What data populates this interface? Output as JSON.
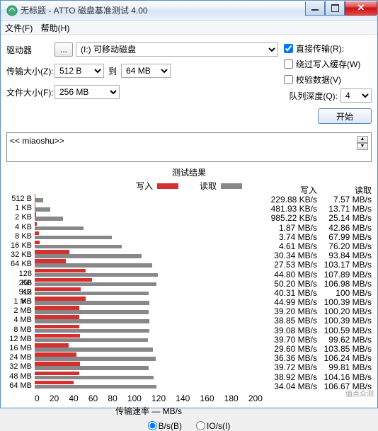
{
  "title": "无标题 - ATTO 磁盘基准测试 4.00",
  "menu": {
    "file": "文件(F)",
    "help": "帮助(H)"
  },
  "form": {
    "drive_lbl": "驱动器",
    "drive_val": "(I:) 可移动磁盘",
    "dots": "...",
    "xfer_lbl": "传输大小(Z):",
    "xfer_from": "512 B",
    "xfer_to_lbl": "到",
    "xfer_to": "64 MB",
    "fsize_lbl": "文件大小(F):",
    "fsize_val": "256 MB"
  },
  "opts": {
    "direct": "直接传输(R):",
    "bypass": "绕过写入缓存(W)",
    "verify": "校验数据(V)",
    "qd_lbl": "队列深度(Q):",
    "qd_val": "4",
    "start": "开始"
  },
  "desc": "<< miaoshu>>",
  "results": {
    "title": "测试结果",
    "write": "写入",
    "read": "读取"
  },
  "axis": {
    "label": "传输速率 — MB/s",
    "ticks": [
      "0",
      "20",
      "40",
      "60",
      "80",
      "100",
      "120",
      "140",
      "160",
      "180",
      "200"
    ]
  },
  "footer": {
    "bs": "B/s(B)",
    "ios": "IO/s(I)"
  },
  "watermark": "值点众测",
  "chart_data": {
    "type": "bar",
    "xlabel": "传输速率 — MB/s",
    "ylabel": "",
    "xlim": [
      0,
      200
    ],
    "categories": [
      "512 B",
      "1 KB",
      "2 KB",
      "4 KB",
      "8 KB",
      "16 KB",
      "32 KB",
      "64 KB",
      "128 KB",
      "256 KB",
      "512 KB",
      "1 MB",
      "2 MB",
      "4 MB",
      "8 MB",
      "12 MB",
      "16 MB",
      "24 MB",
      "32 MB",
      "48 MB",
      "64 MB"
    ],
    "series": [
      {
        "name": "写入",
        "unit_labels": [
          "KB/s",
          "KB/s",
          "KB/s",
          "MB/s",
          "MB/s",
          "MB/s",
          "MB/s",
          "MB/s",
          "MB/s",
          "MB/s",
          "MB/s",
          "MB/s",
          "MB/s",
          "MB/s",
          "MB/s",
          "MB/s",
          "MB/s",
          "MB/s",
          "MB/s",
          "MB/s",
          "MB/s"
        ],
        "display": [
          "229.88",
          "481.93",
          "985.22",
          "1.87",
          "3.74",
          "4.61",
          "30.34",
          "27.53",
          "44.80",
          "50.20",
          "40.31",
          "44.99",
          "39.20",
          "38.85",
          "39.08",
          "39.70",
          "29.60",
          "36.36",
          "39.72",
          "38.92",
          "34.04"
        ],
        "values_mb": [
          0.225,
          0.471,
          0.962,
          1.87,
          3.74,
          4.61,
          30.34,
          27.53,
          44.8,
          50.2,
          40.31,
          44.99,
          39.2,
          38.85,
          39.08,
          39.7,
          29.6,
          36.36,
          39.72,
          38.92,
          34.04
        ]
      },
      {
        "name": "读取",
        "unit_labels": [
          "MB/s",
          "MB/s",
          "MB/s",
          "MB/s",
          "MB/s",
          "MB/s",
          "MB/s",
          "MB/s",
          "MB/s",
          "MB/s",
          "MB/s",
          "MB/s",
          "MB/s",
          "MB/s",
          "MB/s",
          "MB/s",
          "MB/s",
          "MB/s",
          "MB/s",
          "MB/s",
          "MB/s"
        ],
        "display": [
          "7.57",
          "13.71",
          "25.14",
          "42.86",
          "67.99",
          "76.20",
          "93.84",
          "103.17",
          "107.89",
          "106.98",
          "100",
          "100.39",
          "100.20",
          "100.39",
          "100.59",
          "99.62",
          "103.85",
          "106.24",
          "99.81",
          "104.16",
          "106.67"
        ],
        "values_mb": [
          7.57,
          13.71,
          25.14,
          42.86,
          67.99,
          76.2,
          93.84,
          103.17,
          107.89,
          106.98,
          100,
          100.39,
          100.2,
          100.39,
          100.59,
          99.62,
          103.85,
          106.24,
          99.81,
          104.16,
          106.67
        ]
      }
    ]
  }
}
